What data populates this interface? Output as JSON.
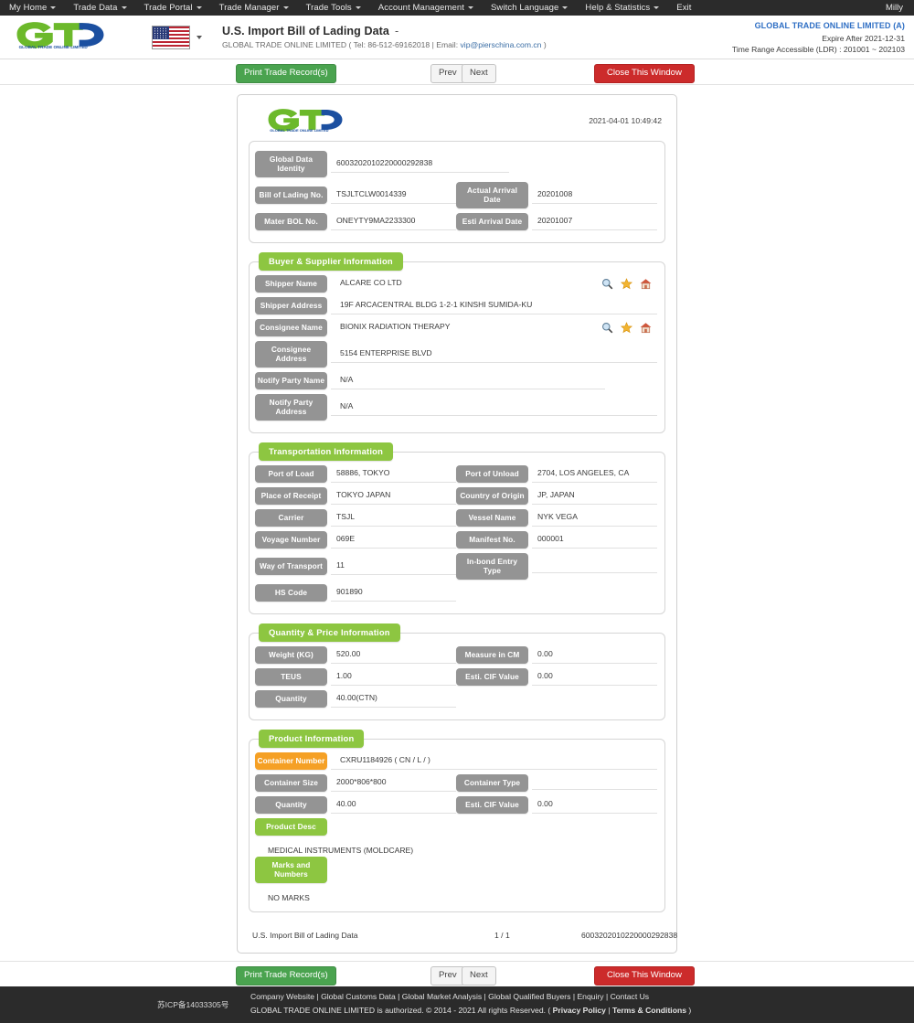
{
  "topnav": {
    "items": [
      {
        "label": "My Home",
        "caret": true
      },
      {
        "label": "Trade Data",
        "caret": true
      },
      {
        "label": "Trade Portal",
        "caret": true
      },
      {
        "label": "Trade Manager",
        "caret": true
      },
      {
        "label": "Trade Tools",
        "caret": true
      },
      {
        "label": "Account Management",
        "caret": true
      },
      {
        "label": "Switch Language",
        "caret": true
      },
      {
        "label": "Help & Statistics",
        "caret": true
      },
      {
        "label": "Exit",
        "caret": false
      }
    ],
    "user": "Milly"
  },
  "header": {
    "logo_text": "GLOBAL TRADE ONLINE LIMITED",
    "flag": "us-flag-icon",
    "title": "U.S. Import Bill of Lading Data",
    "title_dash": "-",
    "subtitle_prefix": "GLOBAL TRADE ONLINE LIMITED ( Tel: 86-512-69162018 | Email: ",
    "subtitle_email": "vip@pierschina.com.cn",
    "subtitle_suffix": " )",
    "account": "GLOBAL TRADE ONLINE LIMITED (A)",
    "expire": "Expire After 2021-12-31",
    "time_range": "Time Range Accessible (LDR) : 201001 ~ 202103"
  },
  "actions": {
    "print": "Print Trade Record(s)",
    "prev": "Prev",
    "next": "Next",
    "close": "Close This Window"
  },
  "doc": {
    "logo_text": "GLOBAL TRADE ONLINE LIMITED",
    "datetime": "2021-04-01 10:49:42",
    "identity": {
      "global_data_identity": {
        "label": "Global Data Identity",
        "value": "6003202010220000292838"
      },
      "bill_of_lading_no": {
        "label": "Bill of Lading No.",
        "value": "TSJLTCLW0014339"
      },
      "actual_arrival_date": {
        "label": "Actual Arrival Date",
        "value": "20201008"
      },
      "mater_bol_no": {
        "label": "Mater BOL No.",
        "value": "ONEYTY9MA2233300"
      },
      "esti_arrival_date": {
        "label": "Esti Arrival Date",
        "value": "20201007"
      }
    },
    "buyer_supplier": {
      "title": "Buyer & Supplier Information",
      "shipper_name": {
        "label": "Shipper Name",
        "value": "ALCARE CO LTD"
      },
      "shipper_address": {
        "label": "Shipper Address",
        "value": "19F ARCACENTRAL BLDG 1-2-1 KINSHI SUMIDA-KU"
      },
      "consignee_name": {
        "label": "Consignee Name",
        "value": "BIONIX RADIATION THERAPY"
      },
      "consignee_address": {
        "label": "Consignee Address",
        "value": "5154 ENTERPRISE BLVD"
      },
      "notify_party_name": {
        "label": "Notify Party Name",
        "value": "N/A"
      },
      "notify_party_address": {
        "label": "Notify Party Address",
        "value": "N/A"
      },
      "icons": [
        "search-icon",
        "star-icon",
        "home-icon"
      ]
    },
    "transportation": {
      "title": "Transportation Information",
      "port_of_load": {
        "label": "Port of Load",
        "value": "58886, TOKYO"
      },
      "port_of_unload": {
        "label": "Port of Unload",
        "value": "2704, LOS ANGELES, CA"
      },
      "place_of_receipt": {
        "label": "Place of Receipt",
        "value": "TOKYO JAPAN"
      },
      "country_of_origin": {
        "label": "Country of Origin",
        "value": "JP, JAPAN"
      },
      "carrier": {
        "label": "Carrier",
        "value": "TSJL"
      },
      "vessel_name": {
        "label": "Vessel Name",
        "value": "NYK VEGA"
      },
      "voyage_number": {
        "label": "Voyage Number",
        "value": "069E"
      },
      "manifest_no": {
        "label": "Manifest No.",
        "value": "000001"
      },
      "way_of_transport": {
        "label": "Way of Transport",
        "value": "11"
      },
      "inbond_entry_type": {
        "label": "In-bond Entry Type",
        "value": ""
      },
      "hs_code": {
        "label": "HS Code",
        "value": "901890"
      }
    },
    "quantity_price": {
      "title": "Quantity & Price Information",
      "weight_kg": {
        "label": "Weight (KG)",
        "value": "520.00"
      },
      "measure_in_cm": {
        "label": "Measure in CM",
        "value": "0.00"
      },
      "teus": {
        "label": "TEUS",
        "value": "1.00"
      },
      "esti_cif_value": {
        "label": "Esti. CIF Value",
        "value": "0.00"
      },
      "quantity": {
        "label": "Quantity",
        "value": "40.00(CTN)"
      }
    },
    "product": {
      "title": "Product Information",
      "container_number": {
        "label": "Container Number",
        "value": "CXRU1184926 ( CN / L /  )"
      },
      "container_size": {
        "label": "Container Size",
        "value": "2000*806*800"
      },
      "container_type": {
        "label": "Container Type",
        "value": ""
      },
      "quantity": {
        "label": "Quantity",
        "value": "40.00"
      },
      "esti_cif_value": {
        "label": "Esti. CIF Value",
        "value": "0.00"
      },
      "product_desc": {
        "label": "Product Desc",
        "value": "MEDICAL INSTRUMENTS (MOLDCARE)"
      },
      "marks_and_numbers": {
        "label": "Marks and Numbers",
        "value": "NO MARKS"
      }
    },
    "footer": {
      "name": "U.S. Import Bill of Lading Data",
      "page": "1 / 1",
      "identity": "6003202010220000292838"
    }
  },
  "pagefooter": {
    "icp": "苏ICP备14033305号",
    "links": "Company Website | Global Customs Data | Global Market Analysis | Global Qualified Buyers | Enquiry | Contact Us",
    "copyright": "GLOBAL TRADE ONLINE LIMITED is authorized. © 2014 - 2021 All rights Reserved.  (",
    "privacy": "Privacy Policy",
    "sep": "|",
    "terms": "Terms & Conditions",
    "closeparen": ")"
  },
  "colors": {
    "green": "#8dc641",
    "gray_label": "#949494",
    "orange": "#f5a025",
    "red": "#cc2b2b",
    "nav_dark": "#2b2b2b",
    "link_blue": "#2f6fc4"
  }
}
